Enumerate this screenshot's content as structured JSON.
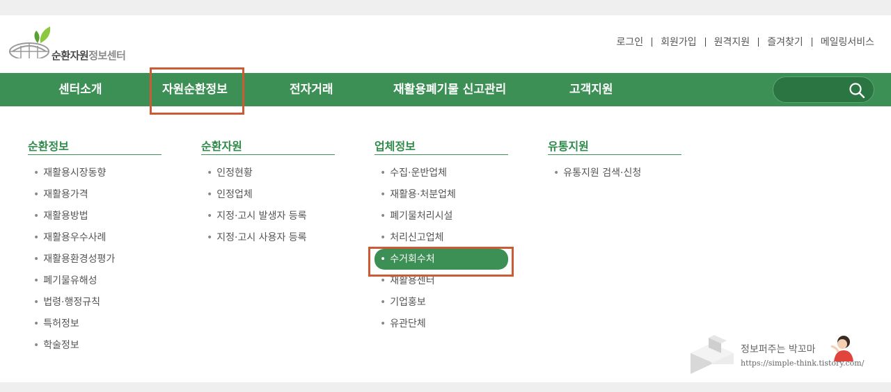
{
  "logo": {
    "text_main": "순환자원",
    "text_sub": "정보센터"
  },
  "util_links": [
    "로그인",
    "회원가입",
    "원격지원",
    "즐겨찾기",
    "메일링서비스"
  ],
  "nav": {
    "items": [
      "센터소개",
      "자원순환정보",
      "전자거래",
      "재활용폐기물 신고관리",
      "고객지원"
    ],
    "active_index": 1
  },
  "search": {
    "placeholder": ""
  },
  "menu": {
    "columns": [
      {
        "title": "순환정보",
        "items": [
          "재활용시장동향",
          "재활용가격",
          "재활용방법",
          "재활용우수사례",
          "재활용환경성평가",
          "폐기물유해성",
          "법령·행정규칙",
          "특허정보",
          "학술정보"
        ]
      },
      {
        "title": "순환자원",
        "items": [
          "인정현황",
          "인정업체",
          "지정·고시 발생자 등록",
          "지정·고시 사용자 등록"
        ]
      },
      {
        "title": "업체정보",
        "items": [
          "수집·운반업체",
          "재활용·처분업체",
          "폐기물처리시설",
          "처리신고업체",
          "수거회수처",
          "재활용센터",
          "기업홍보",
          "유관단체"
        ],
        "active_index": 4
      },
      {
        "title": "유통지원",
        "items": [
          "유통지원 검색·신청"
        ]
      }
    ]
  },
  "watermark": {
    "title": "정보퍼주는 박꼬마",
    "url": "https://simple-think.tistory.com/"
  },
  "colors": {
    "nav_green": "#3c8f55",
    "highlight": "#cc5a35",
    "title_green": "#2f8a4a"
  }
}
